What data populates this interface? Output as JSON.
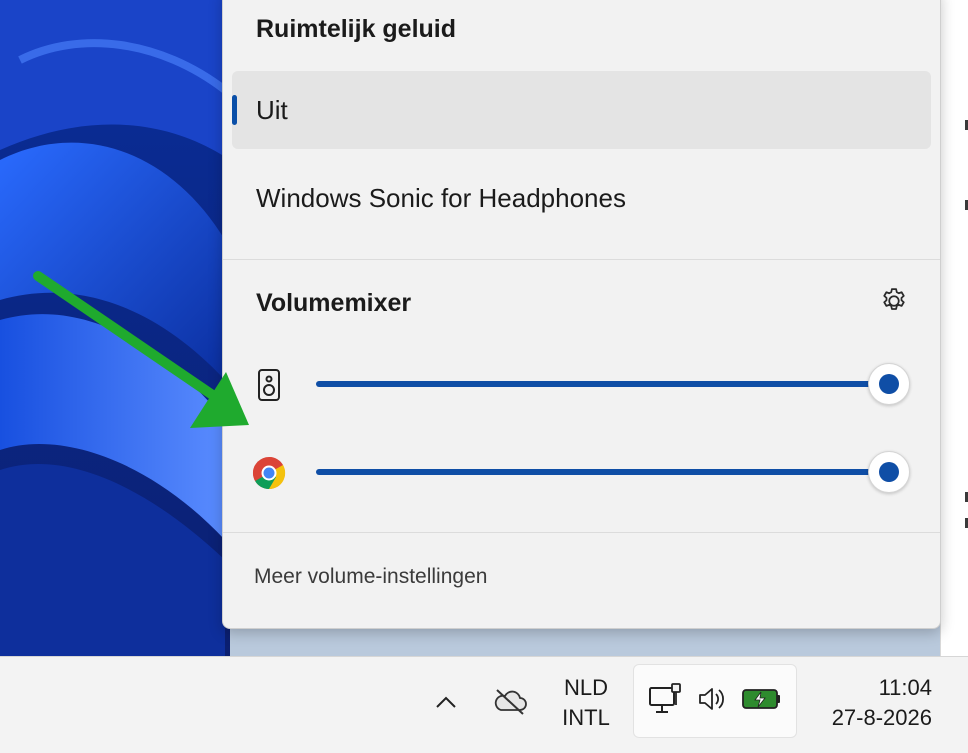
{
  "spatial_sound": {
    "title": "Ruimtelijk geluid",
    "options": [
      {
        "label": "Uit",
        "selected": true
      },
      {
        "label": "Windows Sonic for Headphones",
        "selected": false
      }
    ]
  },
  "volume_mixer": {
    "title": "Volumemixer",
    "settings_icon": "gear-icon",
    "rows": [
      {
        "icon": "speaker-device-icon",
        "volume_fraction": 1.0
      },
      {
        "icon": "chrome-icon",
        "volume_fraction": 1.0
      }
    ]
  },
  "more_settings_link": "Meer volume-instellingen",
  "taskbar": {
    "tray_overflow_icon": "chevron-up-icon",
    "onedrive_icon": "cloud-offline-icon",
    "language": {
      "line1": "NLD",
      "line2": "INTL"
    },
    "quick_icons": [
      "network-wired-icon",
      "volume-icon",
      "battery-charging-icon"
    ],
    "clock": {
      "time": "11:04",
      "date": "27-8-2026"
    }
  },
  "colors": {
    "accent": "#0f4ea6",
    "annotation_arrow": "#1faa2e",
    "battery_green": "#2e8b2e"
  }
}
